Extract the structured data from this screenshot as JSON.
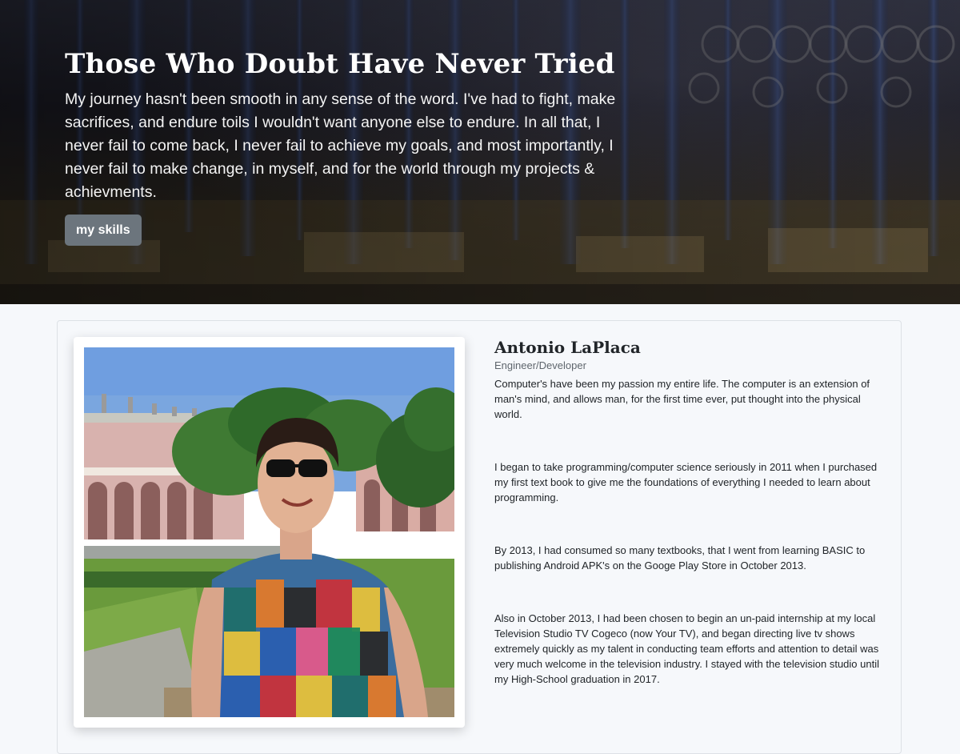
{
  "hero": {
    "title": "Those Who Doubt Have Never Tried",
    "text": "My journey hasn't been smooth in any sense of the word. I've had to fight, make sacrifices, and endure toils I wouldn't want anyone else to endure. In all that, I never fail to come back, I never fail to achieve my goals, and most importantly, I never fail to make change, in myself, and for the world through my projects & achievments.",
    "button_label": "my skills"
  },
  "profile": {
    "name": "Antonio LaPlaca",
    "role": "Engineer/Developer",
    "paragraphs": [
      "Computer's have been my passion my entire life. The computer is an extension of man's mind, and allows man, for the first time ever, put thought into the physical world.",
      "I began to take programming/computer science seriously in 2011 when I purchased my first text book to give me the foundations of everything I needed to learn about programming.",
      "By 2013, I had consumed so many textbooks, that I went from learning BASIC to publishing Android APK's on the Googe Play Store in October 2013.",
      "Also in October 2013, I had been chosen to begin an un-paid internship at my local Television Studio TV Cogeco (now Your TV), and began directing live tv shows extremely quickly as my talent in conducting team efforts and attention to detail was very much welcome in the television industry. I stayed with the television studio until my High-School graduation in 2017."
    ]
  },
  "colors": {
    "page_background": "#f6f8fb",
    "button_background": "#6c757d",
    "text_dark": "#212529",
    "text_muted": "#5f666d"
  }
}
